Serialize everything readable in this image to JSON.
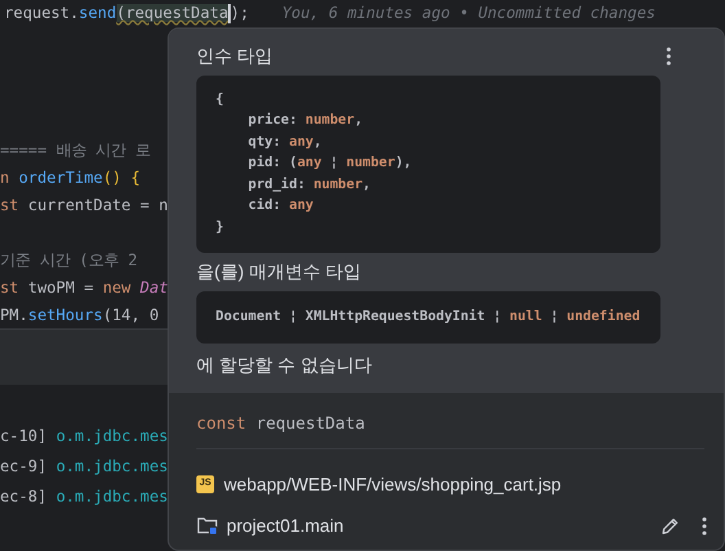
{
  "editor": {
    "blocks": [
      [
        {
          "tokens": [
            {
              "text": "request.",
              "kind": "plain"
            },
            {
              "text": "send",
              "kind": "function"
            },
            {
              "text": "(requestData",
              "kind": "highlighted"
            },
            {
              "text": ");",
              "kind": "plain"
            },
            {
              "text": "You, 6 minutes ago • Uncommitted changes",
              "kind": "annotation"
            }
          ]
        }
      ],
      [
        {
          "tokens": [
            {
              "text": "===== 배송 시간 로",
              "kind": "comment"
            }
          ]
        },
        {
          "tokens": [
            {
              "text": "n ",
              "kind": "keyword"
            },
            {
              "text": "orderTime",
              "kind": "function"
            },
            {
              "text": "() {",
              "kind": "bracket"
            }
          ]
        },
        {
          "tokens": [
            {
              "text": "st ",
              "kind": "keyword"
            },
            {
              "text": "currentDate = n",
              "kind": "plain"
            }
          ]
        }
      ],
      [
        {
          "tokens": [
            {
              "text": "기준 시간 (오후 2",
              "kind": "comment"
            }
          ]
        },
        {
          "tokens": [
            {
              "text": "st ",
              "kind": "keyword"
            },
            {
              "text": "twoPM = ",
              "kind": "plain"
            },
            {
              "text": "new ",
              "kind": "keyword"
            },
            {
              "text": "Dat",
              "kind": "class"
            }
          ]
        },
        {
          "tokens": [
            {
              "text": "PM.",
              "kind": "plain"
            },
            {
              "text": "setHours",
              "kind": "function"
            },
            {
              "text": "(14, 0",
              "kind": "plain"
            }
          ]
        }
      ]
    ]
  },
  "console": {
    "lines": [
      [
        {
          "text": "c-10] ",
          "kind": "plain"
        },
        {
          "text": "o.m.jdbc.mes",
          "kind": "link"
        }
      ],
      [
        {
          "text": "ec-9] ",
          "kind": "plain"
        },
        {
          "text": "o.m.jdbc.mes",
          "kind": "link"
        }
      ],
      [
        {
          "text": "ec-8] ",
          "kind": "plain"
        },
        {
          "text": "o.m.jdbc.mes",
          "kind": "link"
        }
      ]
    ]
  },
  "popup": {
    "title": "인수 타입",
    "argument_type": [
      [
        {
          "text": "{",
          "kind": "plain"
        }
      ],
      [
        {
          "text": "    price: ",
          "kind": "plain"
        },
        {
          "text": "number",
          "kind": "keyword"
        },
        {
          "text": ",",
          "kind": "plain"
        }
      ],
      [
        {
          "text": "    qty: ",
          "kind": "plain"
        },
        {
          "text": "any",
          "kind": "keyword"
        },
        {
          "text": ",",
          "kind": "plain"
        }
      ],
      [
        {
          "text": "    pid: (",
          "kind": "plain"
        },
        {
          "text": "any",
          "kind": "keyword"
        },
        {
          "text": " ¦ ",
          "kind": "plain"
        },
        {
          "text": "number",
          "kind": "keyword"
        },
        {
          "text": "),",
          "kind": "plain"
        }
      ],
      [
        {
          "text": "    prd_id: ",
          "kind": "plain"
        },
        {
          "text": "number",
          "kind": "keyword"
        },
        {
          "text": ",",
          "kind": "plain"
        }
      ],
      [
        {
          "text": "    cid: ",
          "kind": "plain"
        },
        {
          "text": "any",
          "kind": "keyword"
        }
      ],
      [
        {
          "text": "}",
          "kind": "plain"
        }
      ]
    ],
    "middle_text": "을(를) 매개변수 타입",
    "parameter_type": [
      [
        {
          "text": "Document ¦ XMLHttpRequestBodyInit ¦ ",
          "kind": "plain"
        },
        {
          "text": "null",
          "kind": "keyword"
        },
        {
          "text": " ¦ ",
          "kind": "plain"
        },
        {
          "text": "undefined",
          "kind": "keyword"
        }
      ]
    ],
    "end_text": "에 할당할 수 없습니다",
    "declaration": [
      {
        "text": "const ",
        "kind": "keyword"
      },
      {
        "text": "requestData",
        "kind": "plain"
      }
    ],
    "file": "webapp/WEB-INF/views/shopping_cart.jsp",
    "file_badge": "JS",
    "module": "project01.main"
  }
}
